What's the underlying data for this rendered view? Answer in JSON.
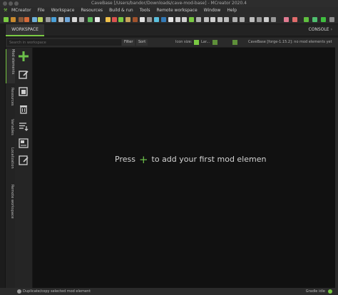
{
  "window": {
    "title": "CaveBase [/Users/bandor/Downloads/cave-mod-base] - MCreator 2020.4"
  },
  "menu": [
    "MCreator",
    "File",
    "Workspace",
    "Resources",
    "Build & run",
    "Tools",
    "Remote workspace",
    "Window",
    "Help"
  ],
  "tabs": {
    "workspace": "WORKSPACE",
    "console": "CONSOLE",
    "console_arrow": "›"
  },
  "side_tabs": [
    "Mod elements",
    "Resources",
    "Variables",
    "Localization",
    "Remote workspace"
  ],
  "search": {
    "placeholder": "Search in workspace",
    "filter_label": "Filter",
    "sort_label": "Sort",
    "icon_size_label": "Icon size:",
    "icon_size_value": "Lar...",
    "workspace_info": "CaveBase [forge-1.15.2]: no mod elements yet"
  },
  "main": {
    "empty_prefix": "Press",
    "empty_plus": "+",
    "empty_suffix": "to add your first mod elemen"
  },
  "status": {
    "hint": "Duplicate/copy selected mod element",
    "gradle": "Gradle idle"
  },
  "colors": {
    "accent_green": "#7ac943",
    "background": "#111111"
  },
  "icons": {
    "tools": [
      "add-element-icon",
      "edit-element-icon",
      "duplicate-element-icon",
      "delete-element-icon",
      "sort-list-icon",
      "export-element-icon",
      "lock-element-icon"
    ]
  }
}
